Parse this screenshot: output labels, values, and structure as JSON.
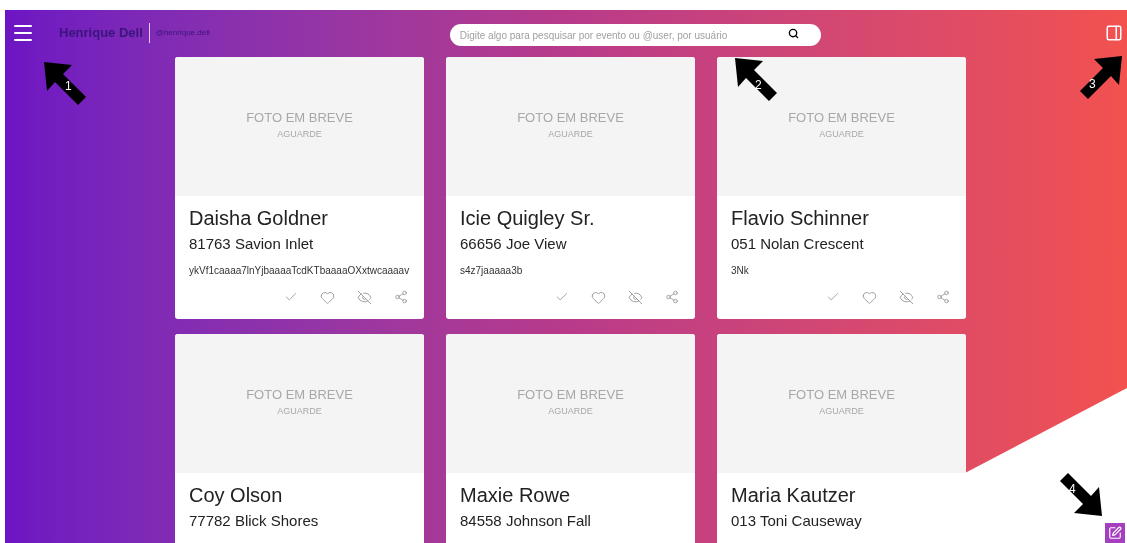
{
  "header": {
    "name": "Henrique Dell",
    "handle": "@henrique.dell"
  },
  "search": {
    "placeholder": "Digite algo para pesquisar por evento ou @user, por usuário"
  },
  "cards": [
    {
      "photo_title": "FOTO EM BREVE",
      "photo_note": "AGUARDE",
      "name": "Daisha Goldner",
      "address": "81763 Savion Inlet",
      "code": "ykVf1caaaa7lnYjbaaaaTcdKTbaaaaOXxtwcaaaav"
    },
    {
      "photo_title": "FOTO EM BREVE",
      "photo_note": "AGUARDE",
      "name": "Icie Quigley Sr.",
      "address": "66656 Joe View",
      "code": "s4z7jaaaaa3b"
    },
    {
      "photo_title": "FOTO EM BREVE",
      "photo_note": "AGUARDE",
      "name": "Flavio Schinner",
      "address": "051 Nolan Crescent",
      "code": "3Nk"
    },
    {
      "photo_title": "FOTO EM BREVE",
      "photo_note": "AGUARDE",
      "name": "Coy Olson",
      "address": "77782 Blick Shores"
    },
    {
      "photo_title": "FOTO EM BREVE",
      "photo_note": "AGUARDE",
      "name": "Maxie Rowe",
      "address": "84558 Johnson Fall"
    },
    {
      "photo_title": "FOTO EM BREVE",
      "photo_note": "AGUARDE",
      "name": "Maria Kautzer",
      "address": "013 Toni Causeway"
    }
  ],
  "annotations": [
    {
      "label": "1",
      "kind": "up-left"
    },
    {
      "label": "2",
      "kind": "up-left"
    },
    {
      "label": "3",
      "kind": "up-right"
    },
    {
      "label": "4",
      "kind": "down-right"
    }
  ]
}
